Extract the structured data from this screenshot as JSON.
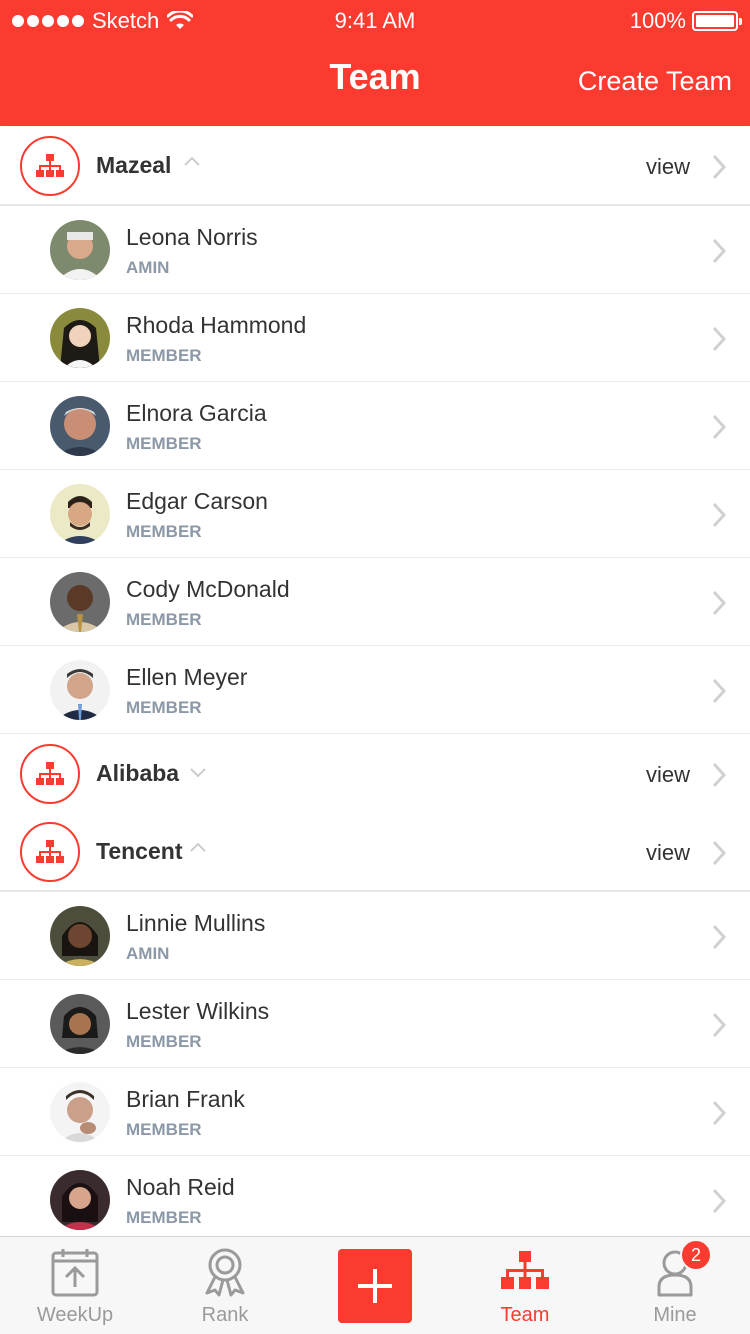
{
  "status_bar": {
    "carrier": "Sketch",
    "time": "9:41 AM",
    "battery": "100%"
  },
  "header": {
    "title": "Team",
    "create_label": "Create Team"
  },
  "colors": {
    "accent": "#fb3b30",
    "role_text": "#8b98a7"
  },
  "teams": [
    {
      "name": "Mazeal",
      "view_label": "view",
      "expanded": true,
      "members": [
        {
          "name": "Leona Norris",
          "role": "AMIN"
        },
        {
          "name": "Rhoda Hammond",
          "role": "MEMBER"
        },
        {
          "name": "Elnora Garcia",
          "role": "MEMBER"
        },
        {
          "name": "Edgar Carson",
          "role": "MEMBER"
        },
        {
          "name": "Cody McDonald",
          "role": "MEMBER"
        },
        {
          "name": "Ellen Meyer",
          "role": "MEMBER"
        }
      ]
    },
    {
      "name": "Alibaba",
      "view_label": "view",
      "expanded": false,
      "members": []
    },
    {
      "name": "Tencent",
      "view_label": "view",
      "expanded": true,
      "members": [
        {
          "name": "Linnie Mullins",
          "role": "AMIN"
        },
        {
          "name": "Lester Wilkins",
          "role": "MEMBER"
        },
        {
          "name": "Brian Frank",
          "role": "MEMBER"
        },
        {
          "name": "Noah Reid",
          "role": "MEMBER"
        }
      ]
    }
  ],
  "tabbar": {
    "tabs": [
      {
        "label": "WeekUp",
        "icon": "calendar-upload-icon"
      },
      {
        "label": "Rank",
        "icon": "award-icon"
      },
      {
        "label": "",
        "icon": "plus-icon"
      },
      {
        "label": "Team",
        "icon": "org-chart-icon",
        "active": true
      },
      {
        "label": "Mine",
        "icon": "person-icon",
        "badge": "2"
      }
    ]
  }
}
